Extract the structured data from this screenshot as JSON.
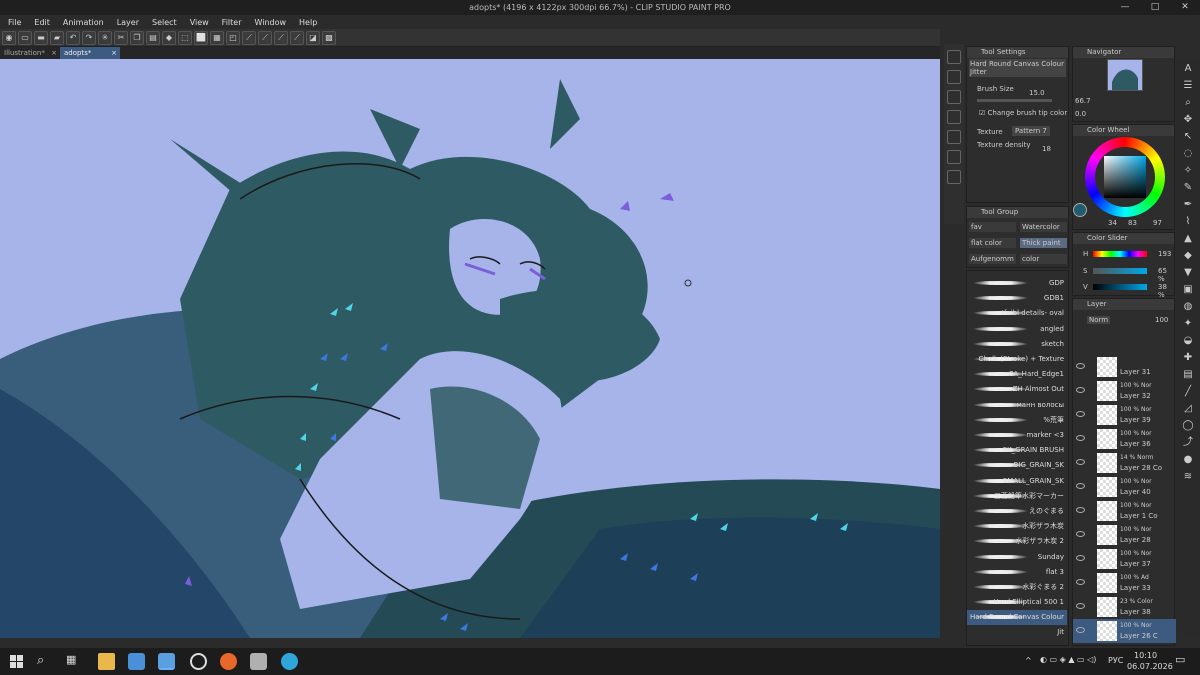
{
  "window": {
    "title": "adopts* (4196 x 4122px 300dpi 66.7%) - CLIP STUDIO PAINT PRO",
    "minimize": "—",
    "maximize": "□",
    "close": "✕"
  },
  "menu": [
    "File",
    "Edit",
    "Animation",
    "Layer",
    "Select",
    "View",
    "Filter",
    "Window",
    "Help"
  ],
  "tabs": [
    {
      "label": "Illustration*",
      "close": "×"
    },
    {
      "label": "adopts*",
      "close": "×"
    }
  ],
  "tool_settings": {
    "header": "Tool Settings",
    "brush_name": "Hard Round Canvas Colour Jitter",
    "brush_size_label": "Brush Size",
    "brush_size_value": "15.0",
    "change_tip_label": "Change brush tip color",
    "texture_label": "Texture",
    "texture_value": "Pattern 7",
    "density_label": "Texture density",
    "density_value": "18"
  },
  "navigator": {
    "header": "Navigator",
    "zoom": "66.7",
    "rotation": "0.0"
  },
  "color_wheel": {
    "header": "Color Wheel",
    "values": [
      "34",
      "83",
      "97"
    ]
  },
  "color_slider": {
    "header": "Color Slider",
    "h_label": "H",
    "h_value": "193",
    "s_label": "S",
    "s_value": "65",
    "v_label": "V",
    "v_value": "38",
    "unit": "%"
  },
  "tool_group": {
    "header": "Tool Group",
    "groups": [
      "fav",
      "Watercolor",
      "flat color",
      "Thick paint",
      "Aufgenomm",
      "color"
    ]
  },
  "brushes": [
    "GDP",
    "GDB1",
    "tfaibl details- oval",
    "angled",
    "sketch",
    "Chalk (Stroke) + Texture",
    "CA_Hard_Edge1",
    "ZH Almost Out",
    "манн волосы",
    "%荒筆",
    "marker <3",
    "SK_GRAIN BRUSH",
    "BIG_GRAIN_SK",
    "SMALL_GRAIN_SK",
    "三菱鉛筆水彩マーカー",
    "えのぐまる",
    "水彩ザラ木炭",
    "水彩ザラ木炭 2",
    "Sunday",
    "flat 3",
    "水彩ぐまる 2",
    "Hard Elliptical 500 1",
    "Hard Round Canvas Colour Jit"
  ],
  "layer_panel": {
    "header": "Layer",
    "blend": "Norm",
    "opacity": "100"
  },
  "layers": [
    {
      "t1": "",
      "t2": "Layer 31"
    },
    {
      "t1": "100 % Nor",
      "t2": "Layer 32"
    },
    {
      "t1": "100 % Nor",
      "t2": "Layer 39"
    },
    {
      "t1": "100 % Nor",
      "t2": "Layer 36"
    },
    {
      "t1": "14 % Norm",
      "t2": "Layer 28 Co"
    },
    {
      "t1": "100 % Nor",
      "t2": "Layer 40"
    },
    {
      "t1": "100 % Nor",
      "t2": "Layer 1 Co"
    },
    {
      "t1": "100 % Nor",
      "t2": "Layer 28"
    },
    {
      "t1": "100 % Nor",
      "t2": "Layer 37"
    },
    {
      "t1": "100 % Ad",
      "t2": "Layer 33"
    },
    {
      "t1": "23 % Color",
      "t2": "Layer 38"
    },
    {
      "t1": "100 % Nor",
      "t2": "Layer 26 C"
    }
  ],
  "tools_right": [
    "A",
    "☰",
    "⌕",
    "✥",
    "↖",
    "◌",
    "✧",
    "✎",
    "✒",
    "⌇",
    "▲",
    "◆",
    "▼",
    "▣",
    "◍",
    "✦",
    "◒",
    "✚",
    "▤",
    "╱",
    "◿",
    "◯",
    "⤴",
    "●",
    "≋"
  ],
  "taskbar": {
    "lang": "РУС",
    "time": "10:10",
    "date": "06.07.2026",
    "tray_arrow": "^"
  },
  "colors": {
    "canvas_bg": "#a6b4ea",
    "creature_teal": "#2e5a63",
    "scale_cyan": "#4fd6e6",
    "scale_blue": "#3d78e0",
    "current_color": "#235b70"
  }
}
